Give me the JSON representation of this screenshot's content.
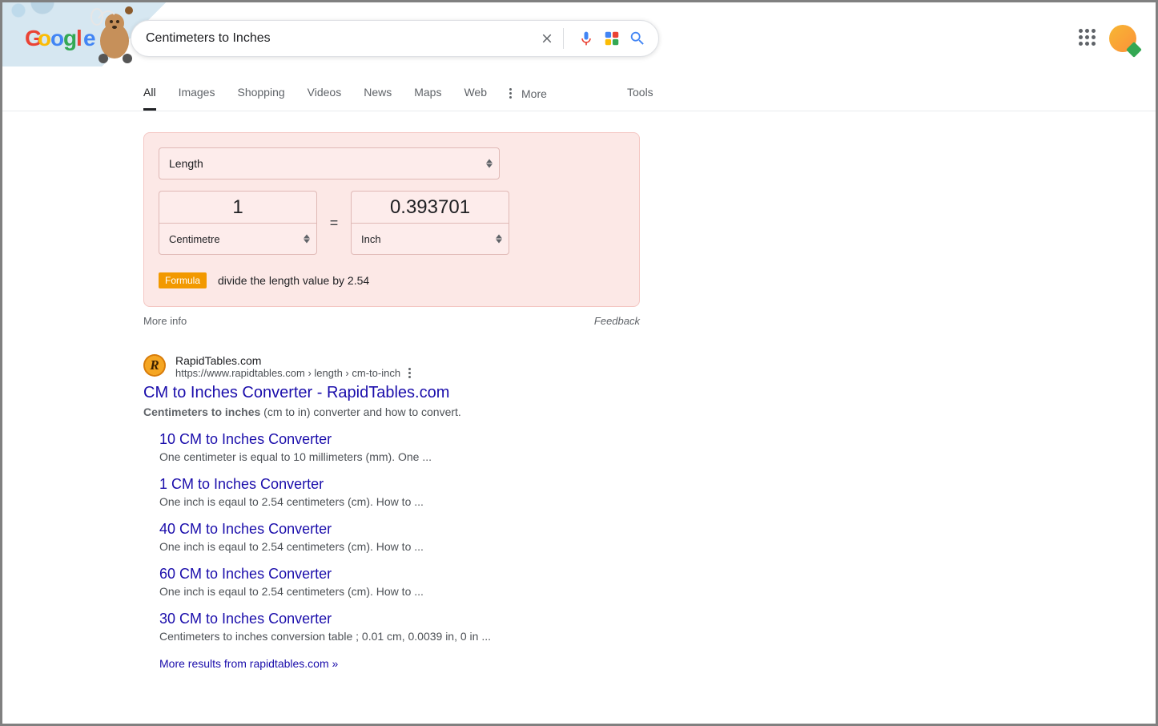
{
  "search": {
    "query": "Centimeters to Inches"
  },
  "tabs": {
    "items": [
      "All",
      "Images",
      "Shopping",
      "Videos",
      "News",
      "Maps",
      "Web"
    ],
    "more": "More",
    "tools": "Tools",
    "active": 0
  },
  "converter": {
    "category": "Length",
    "from_value": "1",
    "from_unit": "Centimetre",
    "to_value": "0.393701",
    "to_unit": "Inch",
    "equals": "=",
    "formula_badge": "Formula",
    "formula_text": "divide the length value by 2.54",
    "more_info": "More info",
    "feedback": "Feedback"
  },
  "result": {
    "site_name": "RapidTables.com",
    "url": "https://www.rapidtables.com › length › cm-to-inch",
    "title": "CM to Inches Converter - RapidTables.com",
    "snippet_bold": "Centimeters to inches",
    "snippet_rest": " (cm to in) converter and how to convert.",
    "subs": [
      {
        "title": "10 CM to Inches Converter",
        "snip": "One centimeter is equal to 10 millimeters (mm). One ..."
      },
      {
        "title": "1 CM to Inches Converter",
        "snip": "One inch is eqaul to 2.54 centimeters (cm). How to ..."
      },
      {
        "title": "40 CM to Inches Converter",
        "snip": "One inch is eqaul to 2.54 centimeters (cm). How to ..."
      },
      {
        "title": "60 CM to Inches Converter",
        "snip": "One inch is eqaul to 2.54 centimeters (cm). How to ..."
      },
      {
        "title": "30 CM to Inches Converter",
        "snip": "Centimeters to inches conversion table ; 0.01 cm, 0.0039 in, 0 in ..."
      }
    ],
    "more_from": "More results from rapidtables.com »"
  },
  "logo_letters": [
    {
      "t": "G",
      "c": "#ea4335"
    },
    {
      "t": "o",
      "c": "#fbbc05"
    },
    {
      "t": "o",
      "c": "#4285f4"
    },
    {
      "t": "g",
      "c": "#34a853"
    },
    {
      "t": "l",
      "c": "#ea4335"
    },
    {
      "t": "e",
      "c": "#4285f4"
    }
  ]
}
